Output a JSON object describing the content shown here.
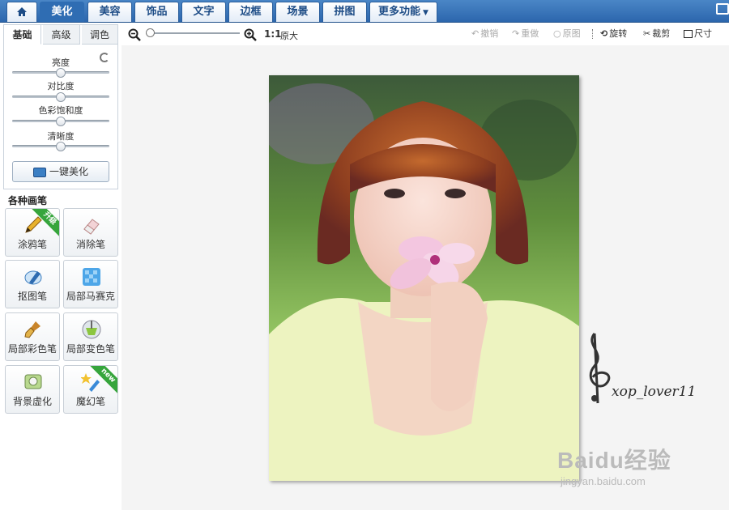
{
  "menu": {
    "home_icon": "home-icon",
    "tabs": [
      {
        "label": "美化",
        "active": true
      },
      {
        "label": "美容",
        "active": false
      },
      {
        "label": "饰品",
        "active": false
      },
      {
        "label": "文字",
        "active": false
      },
      {
        "label": "边框",
        "active": false
      },
      {
        "label": "场景",
        "active": false
      },
      {
        "label": "拼图",
        "active": false
      }
    ],
    "more": "更多功能",
    "accent": "#2f6db3"
  },
  "panel": {
    "subtabs": [
      "基础",
      "高级",
      "调色"
    ],
    "active_subtab": "基础",
    "sliders": [
      {
        "label": "亮度",
        "level": 0.5
      },
      {
        "label": "对比度",
        "level": 0.5
      },
      {
        "label": "色彩饱和度",
        "level": 0.5
      },
      {
        "label": "清晰度",
        "level": 0.5
      }
    ],
    "one_click": "一键美化"
  },
  "brushes": {
    "title": "各种画笔",
    "items": [
      {
        "label": "涂鸦笔",
        "icon": "pencil-icon",
        "badge": "升级"
      },
      {
        "label": "消除笔",
        "icon": "eraser-icon",
        "badge": ""
      },
      {
        "label": "抠图笔",
        "icon": "pen-nib-icon",
        "badge": ""
      },
      {
        "label": "局部马赛克",
        "icon": "mosaic-icon",
        "badge": ""
      },
      {
        "label": "局部彩色笔",
        "icon": "paintbrush-icon",
        "badge": ""
      },
      {
        "label": "局部变色笔",
        "icon": "paint-bucket-icon",
        "badge": ""
      },
      {
        "label": "背景虚化",
        "icon": "blur-icon",
        "badge": ""
      },
      {
        "label": "魔幻笔",
        "icon": "magic-pen-icon",
        "badge": "new"
      }
    ]
  },
  "toolbar": {
    "ratio": "1:1",
    "original_size": "原大",
    "undo": "撤销",
    "redo": "重做",
    "original": "原图",
    "rotate": "旋转",
    "crop": "裁剪",
    "size": "尺寸",
    "zoom_level": 0.0
  },
  "image": {
    "signature": "xop_lover11",
    "watermark_main": "Baidu经验",
    "watermark_sub": "jingyan.baidu.com"
  }
}
